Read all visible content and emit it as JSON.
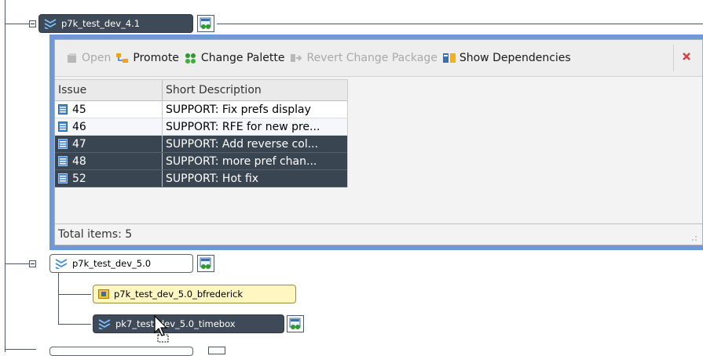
{
  "streams": [
    {
      "name": "p7k_test_dev_4.1"
    },
    {
      "name": "p7k_test_dev_5.0"
    }
  ],
  "workspaces": [
    {
      "name": "p7k_test_dev_5.0_bfrederick"
    }
  ],
  "child_streams": [
    {
      "name": "pk7_test_dev_5.0_timebox"
    }
  ],
  "toolbar": {
    "open_label": "Open",
    "promote_label": "Promote",
    "change_palette_label": "Change Palette",
    "revert_label": "Revert Change Package",
    "show_dependencies_label": "Show Dependencies"
  },
  "table": {
    "columns": [
      "Issue",
      "Short Description"
    ],
    "rows": [
      {
        "issue": "45",
        "description": "SUPPORT: Fix prefs display",
        "selected": false
      },
      {
        "issue": "46",
        "description": "SUPPORT: RFE for new pre...",
        "selected": false
      },
      {
        "issue": "47",
        "description": "SUPPORT: Add reverse col...",
        "selected": true
      },
      {
        "issue": "48",
        "description": "SUPPORT: more pref chan...",
        "selected": true
      },
      {
        "issue": "52",
        "description": "SUPPORT: Hot fix",
        "selected": true
      }
    ]
  },
  "status": {
    "total_items": "Total items: 5"
  },
  "colors": {
    "panel_border": "#6f99d6",
    "selected_row": "#3a4552",
    "stream_dark": "#3e4a58",
    "workspace": "#fff6c2"
  }
}
